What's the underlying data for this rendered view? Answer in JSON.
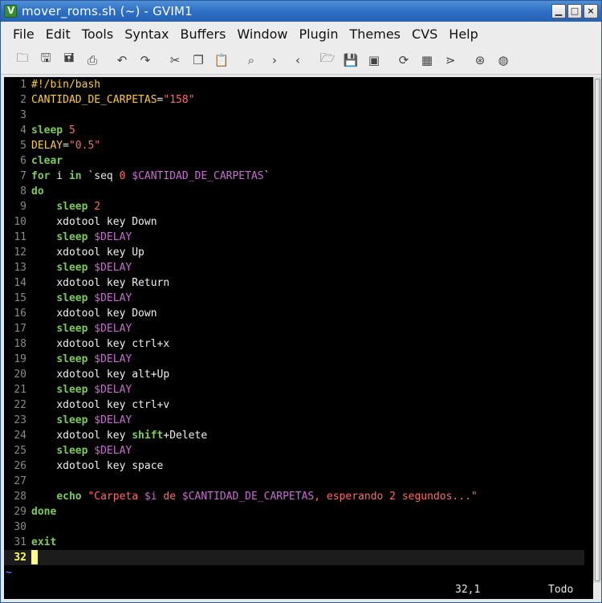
{
  "window": {
    "title": "mover_roms.sh (~) - GVIM1",
    "buttons": {
      "minimize": "▁",
      "maximize": "□",
      "close": "×"
    }
  },
  "menu": [
    "File",
    "Edit",
    "Tools",
    "Syntax",
    "Buffers",
    "Window",
    "Plugin",
    "Themes",
    "CVS",
    "Help"
  ],
  "toolbar": [
    {
      "name": "open-icon",
      "glyph": "🗀"
    },
    {
      "name": "save-icon",
      "glyph": "🖫"
    },
    {
      "name": "save-all-icon",
      "glyph": "🖬"
    },
    {
      "name": "print-icon",
      "glyph": "⎙"
    },
    {
      "sep": true
    },
    {
      "name": "undo-icon",
      "glyph": "↶"
    },
    {
      "name": "redo-icon",
      "glyph": "↷"
    },
    {
      "sep": true
    },
    {
      "name": "cut-icon",
      "glyph": "✂"
    },
    {
      "name": "copy-icon",
      "glyph": "❐"
    },
    {
      "name": "paste-icon",
      "glyph": "📋"
    },
    {
      "sep": true
    },
    {
      "name": "find-icon",
      "glyph": "⌕"
    },
    {
      "name": "find-next-icon",
      "glyph": "›"
    },
    {
      "name": "find-prev-icon",
      "glyph": "‹"
    },
    {
      "sep": true
    },
    {
      "name": "load-session-icon",
      "glyph": "🗁"
    },
    {
      "name": "save-session-icon",
      "glyph": "💾"
    },
    {
      "name": "run-script-icon",
      "glyph": "▣"
    },
    {
      "sep": true
    },
    {
      "name": "make-icon",
      "glyph": "⟳"
    },
    {
      "name": "shell-icon",
      "glyph": "▦"
    },
    {
      "name": "tags-jump-icon",
      "glyph": "⋗"
    },
    {
      "sep": true
    },
    {
      "name": "help-icon",
      "glyph": "⊛"
    },
    {
      "name": "find-help-icon",
      "glyph": "◍"
    }
  ],
  "editor": {
    "lines": [
      [
        [
          "ident",
          "#!/bin/bash"
        ]
      ],
      [
        [
          "ident",
          "CANTIDAD_DE_CARPETAS"
        ],
        [
          "punct",
          "="
        ],
        [
          "str",
          "\"158\""
        ]
      ],
      [],
      [
        [
          "kw",
          "sleep"
        ],
        [
          "punct",
          " "
        ],
        [
          "num",
          "5"
        ]
      ],
      [
        [
          "ident",
          "DELAY"
        ],
        [
          "punct",
          "="
        ],
        [
          "str",
          "\"0.5\""
        ]
      ],
      [
        [
          "kw",
          "clear"
        ]
      ],
      [
        [
          "kw",
          "for"
        ],
        [
          "punct",
          " i "
        ],
        [
          "kw",
          "in"
        ],
        [
          "punct",
          " `seq "
        ],
        [
          "num",
          "0"
        ],
        [
          "punct",
          " "
        ],
        [
          "var",
          "$CANTIDAD_DE_CARPETAS"
        ],
        [
          "punct",
          "`"
        ]
      ],
      [
        [
          "kw",
          "do"
        ]
      ],
      [
        [
          "punct",
          "    "
        ],
        [
          "kw",
          "sleep"
        ],
        [
          "punct",
          " "
        ],
        [
          "num",
          "2"
        ]
      ],
      [
        [
          "punct",
          "    "
        ],
        [
          "cmd",
          "xdotool key Down"
        ]
      ],
      [
        [
          "punct",
          "    "
        ],
        [
          "kw",
          "sleep"
        ],
        [
          "punct",
          " "
        ],
        [
          "var",
          "$DELAY"
        ]
      ],
      [
        [
          "punct",
          "    "
        ],
        [
          "cmd",
          "xdotool key Up"
        ]
      ],
      [
        [
          "punct",
          "    "
        ],
        [
          "kw",
          "sleep"
        ],
        [
          "punct",
          " "
        ],
        [
          "var",
          "$DELAY"
        ]
      ],
      [
        [
          "punct",
          "    "
        ],
        [
          "cmd",
          "xdotool key Return"
        ]
      ],
      [
        [
          "punct",
          "    "
        ],
        [
          "kw",
          "sleep"
        ],
        [
          "punct",
          " "
        ],
        [
          "var",
          "$DELAY"
        ]
      ],
      [
        [
          "punct",
          "    "
        ],
        [
          "cmd",
          "xdotool key Down"
        ]
      ],
      [
        [
          "punct",
          "    "
        ],
        [
          "kw",
          "sleep"
        ],
        [
          "punct",
          " "
        ],
        [
          "var",
          "$DELAY"
        ]
      ],
      [
        [
          "punct",
          "    "
        ],
        [
          "cmd",
          "xdotool key ctrl+x"
        ]
      ],
      [
        [
          "punct",
          "    "
        ],
        [
          "kw",
          "sleep"
        ],
        [
          "punct",
          " "
        ],
        [
          "var",
          "$DELAY"
        ]
      ],
      [
        [
          "punct",
          "    "
        ],
        [
          "cmd",
          "xdotool key alt+Up"
        ]
      ],
      [
        [
          "punct",
          "    "
        ],
        [
          "kw",
          "sleep"
        ],
        [
          "punct",
          " "
        ],
        [
          "var",
          "$DELAY"
        ]
      ],
      [
        [
          "punct",
          "    "
        ],
        [
          "cmd",
          "xdotool key ctrl+v"
        ]
      ],
      [
        [
          "punct",
          "    "
        ],
        [
          "kw",
          "sleep"
        ],
        [
          "punct",
          " "
        ],
        [
          "var",
          "$DELAY"
        ]
      ],
      [
        [
          "punct",
          "    "
        ],
        [
          "cmd",
          "xdotool key "
        ],
        [
          "kw",
          "shift"
        ],
        [
          "cmd",
          "+Delete"
        ]
      ],
      [
        [
          "punct",
          "    "
        ],
        [
          "kw",
          "sleep"
        ],
        [
          "punct",
          " "
        ],
        [
          "var",
          "$DELAY"
        ]
      ],
      [
        [
          "punct",
          "    "
        ],
        [
          "cmd",
          "xdotool key space"
        ]
      ],
      [],
      [
        [
          "punct",
          "    "
        ],
        [
          "kw",
          "echo"
        ],
        [
          "punct",
          " "
        ],
        [
          "str",
          "\"Carpeta "
        ],
        [
          "var",
          "$i"
        ],
        [
          "str",
          " de "
        ],
        [
          "var",
          "$CANTIDAD_DE_CARPETAS"
        ],
        [
          "str",
          ", esperando 2 segundos...\""
        ]
      ],
      [
        [
          "kw",
          "done"
        ]
      ],
      [],
      [
        [
          "kw",
          "exit"
        ]
      ],
      []
    ],
    "current_line": 32,
    "tilde": "~"
  },
  "status": {
    "position": "32,1",
    "scroll": "Todo"
  }
}
